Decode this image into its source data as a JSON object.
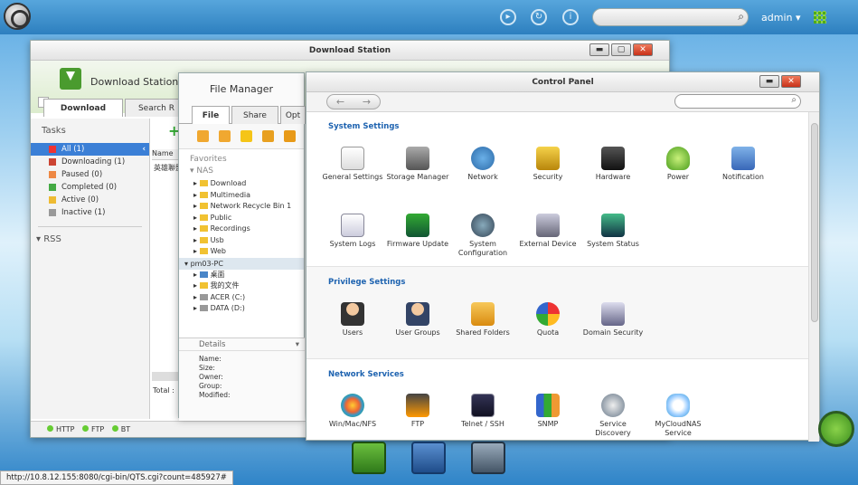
{
  "topbar": {
    "user": "admin",
    "user_caret": "▾",
    "search_placeholder": "",
    "search_icon": "⌕",
    "info_icon": "i"
  },
  "download_station": {
    "title": "Download Station",
    "app_name": "Download Station",
    "tabs": [
      "Download",
      "Search R"
    ],
    "tasks_header": "Tasks",
    "tasks": [
      "All (1)",
      "Downloading (1)",
      "Paused (0)",
      "Completed (0)",
      "Active (0)",
      "Inactive (1)"
    ],
    "rss_label": "RSS",
    "col_name": "Name",
    "row_name": "英雄聯盟",
    "total_label": "Total :",
    "footer": [
      "HTTP",
      "FTP",
      "BT"
    ]
  },
  "file_manager": {
    "title": "File Manager",
    "tabs": [
      "File",
      "Share",
      "Opt"
    ],
    "favorites": "Favorites",
    "nas": "NAS",
    "nas_folders": [
      "Download",
      "Multimedia",
      "Network Recycle Bin 1",
      "Public",
      "Recordings",
      "Usb",
      "Web"
    ],
    "pc": "pm03-PC",
    "pc_items": [
      "桌面",
      "我的文件",
      "ACER (C:)",
      "DATA (D:)"
    ],
    "details_label": "Details",
    "detail_fields": [
      "Name:",
      "Size:",
      "Owner:",
      "Group:",
      "Modified:"
    ]
  },
  "control_panel": {
    "title": "Control Panel",
    "search_placeholder": "",
    "system_settings": {
      "title": "System Settings",
      "items": [
        {
          "label": "General Settings",
          "icon": "general-settings-icon"
        },
        {
          "label": "Storage Manager",
          "icon": "storage-manager-icon"
        },
        {
          "label": "Network",
          "icon": "network-icon"
        },
        {
          "label": "Security",
          "icon": "security-icon"
        },
        {
          "label": "Hardware",
          "icon": "hardware-icon"
        },
        {
          "label": "Power",
          "icon": "power-icon"
        },
        {
          "label": "Notification",
          "icon": "notification-icon"
        },
        {
          "label": "System Logs",
          "icon": "system-logs-icon"
        },
        {
          "label": "Firmware Update",
          "icon": "firmware-update-icon"
        },
        {
          "label": "System Configuration",
          "icon": "system-configuration-icon"
        },
        {
          "label": "External Device",
          "icon": "external-device-icon"
        },
        {
          "label": "System Status",
          "icon": "system-status-icon"
        }
      ]
    },
    "privilege_settings": {
      "title": "Privilege Settings",
      "items": [
        {
          "label": "Users",
          "icon": "users-icon"
        },
        {
          "label": "User Groups",
          "icon": "user-groups-icon"
        },
        {
          "label": "Shared Folders",
          "icon": "shared-folders-icon"
        },
        {
          "label": "Quota",
          "icon": "quota-icon"
        },
        {
          "label": "Domain Security",
          "icon": "domain-security-icon"
        }
      ]
    },
    "network_services": {
      "title": "Network Services",
      "items": [
        {
          "label": "Win/Mac/NFS",
          "icon": "win-mac-nfs-icon"
        },
        {
          "label": "FTP",
          "icon": "ftp-icon"
        },
        {
          "label": "Telnet / SSH",
          "icon": "telnet-ssh-icon"
        },
        {
          "label": "SNMP",
          "icon": "snmp-icon"
        },
        {
          "label": "Service Discovery",
          "icon": "service-discovery-icon"
        },
        {
          "label": "MyCloudNAS Service",
          "icon": "mycloudnas-icon"
        }
      ]
    }
  },
  "status_url": "http://10.8.12.155:8080/cgi-bin/QTS.cgi?count=485927#"
}
